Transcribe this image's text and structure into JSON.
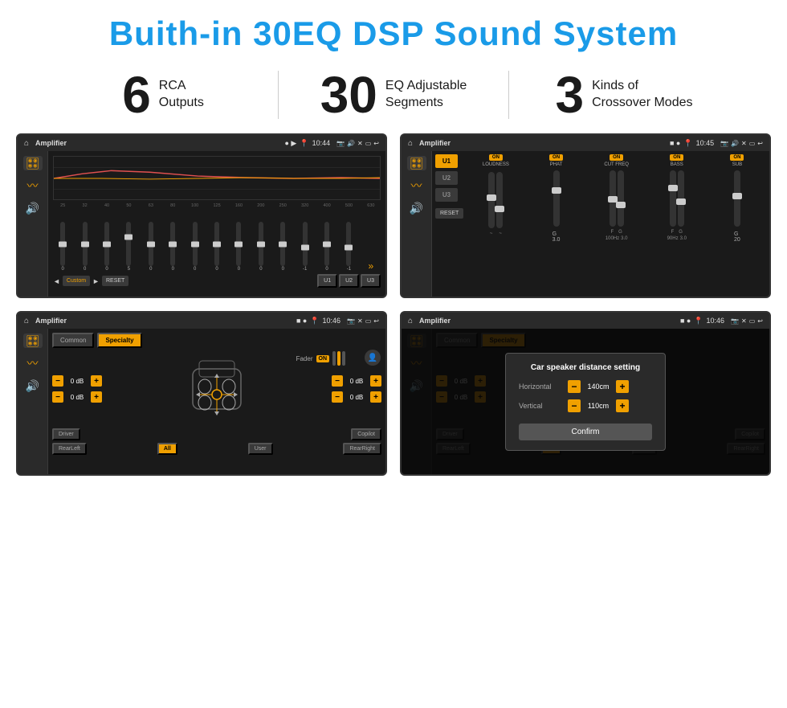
{
  "header": {
    "title": "Buith-in 30EQ DSP Sound System"
  },
  "stats": [
    {
      "number": "6",
      "label": "RCA\nOutputs"
    },
    {
      "number": "30",
      "label": "EQ Adjustable\nSegments"
    },
    {
      "number": "3",
      "label": "Kinds of\nCrossover Modes"
    }
  ],
  "screens": {
    "eq": {
      "title": "Amplifier",
      "time": "10:44",
      "freqs": [
        "25",
        "32",
        "40",
        "50",
        "63",
        "80",
        "100",
        "125",
        "160",
        "200",
        "250",
        "320",
        "400",
        "500",
        "630"
      ],
      "vals": [
        "0",
        "0",
        "0",
        "5",
        "0",
        "0",
        "0",
        "0",
        "0",
        "0",
        "0",
        "-1",
        "0",
        "-1"
      ],
      "buttons": [
        "Custom",
        "RESET",
        "U1",
        "U2",
        "U3"
      ]
    },
    "dsp": {
      "title": "Amplifier",
      "time": "10:45",
      "uButtons": [
        "U1",
        "U2",
        "U3"
      ],
      "controls": [
        "LOUDNESS",
        "PHAT",
        "CUT FREQ",
        "BASS",
        "SUB"
      ]
    },
    "fader": {
      "title": "Amplifier",
      "time": "10:46",
      "tabs": [
        "Common",
        "Specialty"
      ],
      "faderLabel": "Fader",
      "db_values": [
        "0 dB",
        "0 dB",
        "0 dB",
        "0 dB"
      ],
      "bottomBtns": [
        "Driver",
        "",
        "Copilot",
        "RearLeft",
        "All",
        "",
        "User",
        "RearRight"
      ]
    },
    "distance": {
      "title": "Amplifier",
      "time": "10:46",
      "modal": {
        "title": "Car speaker distance setting",
        "horizontal_label": "Horizontal",
        "horizontal_value": "140cm",
        "vertical_label": "Vertical",
        "vertical_value": "110cm",
        "confirm_label": "Confirm"
      },
      "bottomBtns": [
        "Driver",
        "",
        "Copilot",
        "RearLeft",
        "All",
        "",
        "User",
        "RearRight"
      ]
    }
  },
  "colors": {
    "accent": "#f0a000",
    "blue": "#1a9be8",
    "bg_dark": "#1a1a1a",
    "text_light": "#ffffff"
  }
}
